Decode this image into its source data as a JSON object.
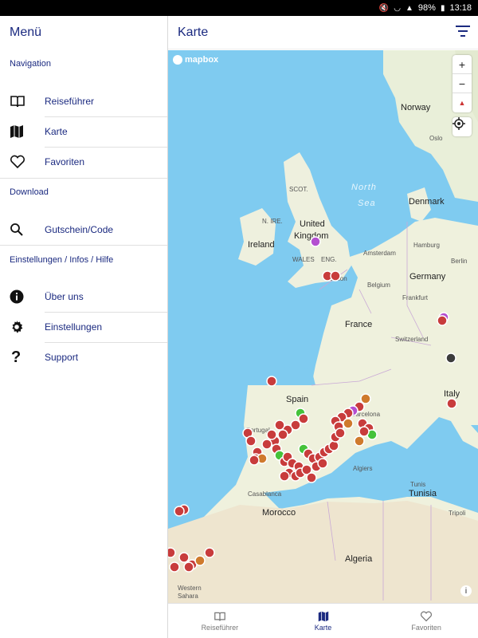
{
  "status": {
    "battery": "98%",
    "time": "13:18"
  },
  "drawer": {
    "title": "Menü",
    "sections": {
      "navigation": "Navigation",
      "download": "Download",
      "settings": "Einstellungen / Infos / Hilfe"
    },
    "items": [
      {
        "label": "Reiseführer",
        "icon": "book-icon"
      },
      {
        "label": "Karte",
        "icon": "map-icon"
      },
      {
        "label": "Favoriten",
        "icon": "heart-icon"
      },
      {
        "label": "Gutschein/Code",
        "icon": "search-icon"
      },
      {
        "label": "Über uns",
        "icon": "info-icon"
      },
      {
        "label": "Einstellungen",
        "icon": "gear-icon"
      },
      {
        "label": "Support",
        "icon": "question-icon"
      }
    ]
  },
  "header": {
    "title": "Karte"
  },
  "map": {
    "attribution": "mapbox",
    "zoom_in": "+",
    "zoom_out": "−",
    "compass": "▲",
    "info": "i",
    "labels": {
      "norway": "Norway",
      "oslo": "Oslo",
      "scot": "SCOT.",
      "north_sea_1": "North",
      "north_sea_2": "Sea",
      "denmark": "Denmark",
      "nire": "N. IRE.",
      "uk_1": "United",
      "uk_2": "Kingdom",
      "ireland": "Ireland",
      "wales": "WALES",
      "eng": "ENG.",
      "amsterdam": "Amsterdam",
      "hamburg": "Hamburg",
      "berlin": "Berlin",
      "london": "London",
      "germany": "Germany",
      "belgium": "Belgium",
      "frankfurt": "Frankfurt",
      "france": "France",
      "switzerland": "Switzerland",
      "spain": "Spain",
      "italy": "Italy",
      "portugal": "Portugal",
      "barcelona": "Barcelona",
      "algiers": "Algiers",
      "casablanca": "Casablanca",
      "morocco": "Morocco",
      "tunisia": "Tunisia",
      "tunis": "Tunis",
      "tripoli": "Tripoli",
      "algeria": "Algeria",
      "western_sahara_1": "Western",
      "western_sahara_2": "Sahara"
    }
  },
  "bottom_nav": [
    {
      "label": "Reiseführer",
      "icon": "book-icon",
      "active": false
    },
    {
      "label": "Karte",
      "icon": "map-icon",
      "active": true
    },
    {
      "label": "Favoriten",
      "icon": "heart-icon",
      "active": false
    }
  ],
  "colors": {
    "accent": "#1b2a80",
    "water": "#7fcbf0",
    "land": "#f1f0df",
    "marker_red": "#c83c3c",
    "marker_green": "#45c23a",
    "marker_orange": "#cf7a2c",
    "marker_purple": "#b44fd0",
    "marker_gray": "#3c3c3c"
  }
}
